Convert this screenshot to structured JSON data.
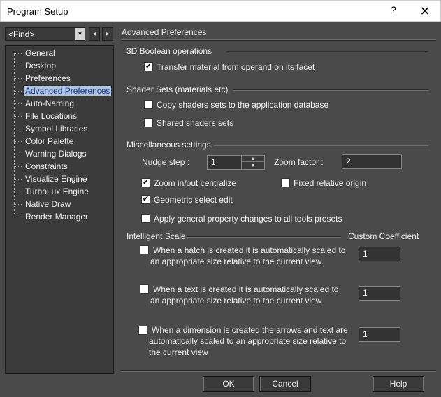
{
  "window": {
    "title": "Program Setup",
    "help_glyph": "?",
    "close_glyph": "✕"
  },
  "find": {
    "value": "<Find>",
    "arrow": "▾",
    "back": "◂",
    "forward": "▸"
  },
  "tree": {
    "items": [
      {
        "label": "General"
      },
      {
        "label": "Desktop"
      },
      {
        "label": "Preferences"
      },
      {
        "label": "Advanced Preferences",
        "selected": true
      },
      {
        "label": "Auto-Naming"
      },
      {
        "label": "File Locations"
      },
      {
        "label": "Symbol Libraries"
      },
      {
        "label": "Color Palette"
      },
      {
        "label": "Warning Dialogs"
      },
      {
        "label": "Constraints"
      },
      {
        "label": "Visualize Engine"
      },
      {
        "label": "TurboLux Engine"
      },
      {
        "label": "Native Draw"
      },
      {
        "label": "Render Manager"
      }
    ]
  },
  "panel": {
    "title": "Advanced Preferences",
    "boolean": {
      "heading": "3D Boolean operations",
      "transfer_material": {
        "label": "Transfer material from operand  on its facet",
        "checked": true
      }
    },
    "shaders": {
      "heading": "Shader Sets (materials etc)",
      "copy_sets": {
        "label": "Copy shaders sets to the application database",
        "checked": false
      },
      "shared_sets": {
        "label": "Shared shaders sets",
        "checked": false
      }
    },
    "misc": {
      "heading": "Miscellaneous settings",
      "nudge_label_u": "N",
      "nudge_label_rest": "udge step :",
      "nudge_value": "1",
      "zoom_label_pre": "Zo",
      "zoom_label_u": "o",
      "zoom_label_rest": "m factor :",
      "zoom_value": "2",
      "zoom_centralize": {
        "label": "Zoom in/out centralize",
        "checked": true
      },
      "fixed_origin": {
        "label": "Fixed relative origin",
        "checked": false
      },
      "geometric_select": {
        "label": "Geometric select edit",
        "checked": true
      },
      "apply_general": {
        "label": "Apply general property changes to all tools presets",
        "checked": false
      }
    },
    "scale": {
      "heading": "Intelligent Scale",
      "coef_heading": "Custom Coefficient",
      "hatch": {
        "line1": "When a hatch is created it is automatically scaled to",
        "line2": "an appropriate size relative to the current view.",
        "checked": false,
        "coef": "1"
      },
      "text": {
        "line1": "When a text is created it is automatically scaled to",
        "line2": "an appropriate size relative to the current view",
        "checked": false,
        "coef": "1"
      },
      "dimension": {
        "line1": "When a dimension is created the arrows and text are",
        "line2": "automatically scaled to an appropriate size relative to",
        "line3": "the current view",
        "checked": false,
        "coef": "1"
      }
    }
  },
  "buttons": {
    "ok": "OK",
    "cancel": "Cancel",
    "help": "Help"
  }
}
